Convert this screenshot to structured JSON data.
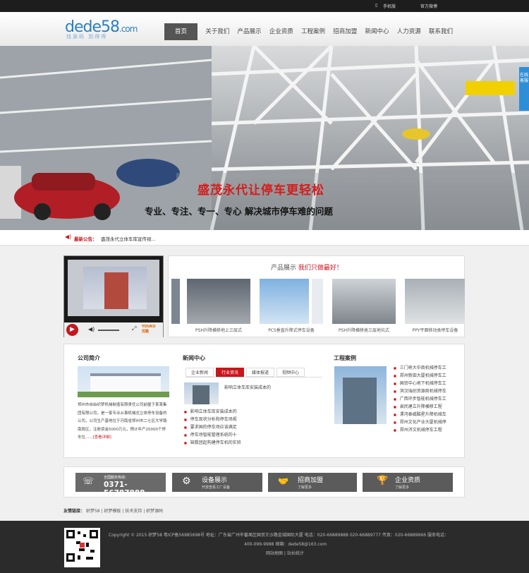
{
  "topbar": {
    "mobile": "手机版",
    "weibo": "官方微博"
  },
  "logo": {
    "main": "dede58",
    "domain": ".com",
    "slogan": "找源码  到得得"
  },
  "nav": [
    "首页",
    "关于我们",
    "产品展示",
    "企业资质",
    "工程案例",
    "招商加盟",
    "新闻中心",
    "人力资源",
    "联系我们"
  ],
  "banner": {
    "headline": "盛茂永代让停车更轻松",
    "subline": "专业、专注、专一、专心 解决城市停车难的问题"
  },
  "side_tab": "在线客服",
  "notice": {
    "label": "最新公告：",
    "text": "盛茂永代立体车库宣传视..."
  },
  "video": {
    "brand": "YOUKU 优酷"
  },
  "products": {
    "title": "产品展示",
    "slogan": "我们只做最好！",
    "items": [
      "PSH升降横移地上三层式",
      "PCS垂直升降式停车设备",
      "PSH升降横移类三层地坑式",
      "PPY平面移动类停车设备"
    ]
  },
  "company": {
    "title": "公司简介",
    "text": "郑州市自由织梦机械制造有限责任公司前屋于某某集团有限公司，是一家专业从事机械式立体停车设备的公司，公司生产基地位于河南省郑州市二七区大学路南段区，注册资金5000万元，预计年产20000个停车位......",
    "more": "[查看详细]"
  },
  "news": {
    "title": "新闻中心",
    "tabs": [
      "企业新闻",
      "行业资讯",
      "媒体报道",
      "视频中心"
    ],
    "active_tab": 1,
    "featured": "影响立体车库安装成本的",
    "items": [
      "影响立体车库安装成本的",
      "停车现状分析和停车场规",
      "要求国的停车场应该满足",
      "停车场智能管理系统的十",
      "缺数团起构建停车机的实验"
    ]
  },
  "cases": {
    "title": "工程案例",
    "items": [
      "三门峡大中商机械停车工",
      "郑州新田大厦机械停车工",
      "国贸中心地下机械停车工",
      "滨汉瑞创资源商机械停车",
      "广西环步智能机械停车工",
      "县民建立升降横移工程",
      "漯河泰威酷星升降机械车",
      "郑州文化产业大厦机械停",
      "郑州济文机械停车工程"
    ]
  },
  "services": [
    {
      "title": "全国服务热线：",
      "value": "0371-56787888"
    },
    {
      "title": "设备展示",
      "value": "开放查看工厂设备"
    },
    {
      "title": "招商加盟",
      "value": "了解更多"
    },
    {
      "title": "企业资质",
      "value": "了解更多"
    }
  ],
  "friend_links": {
    "label": "友情链接：",
    "items": [
      "织梦58",
      "织梦模板",
      "技术支持",
      "织梦源码"
    ]
  },
  "footer": {
    "line1": "Copyright © 2015  织梦58 粤ICP备56985698号  地址：广东省广州市番禺区国贸王沙路金城国际大厦   电话：020-66889888 020-66889777  传真：020-66889666 服务电话：",
    "line2": "400-099-9988  邮箱：dede58@163.com",
    "line3": "网站地图 | 站长统计"
  },
  "colors": {
    "accent": "#c8161d",
    "dark": "#2b2b2b",
    "logo": "#2b7fc1"
  }
}
